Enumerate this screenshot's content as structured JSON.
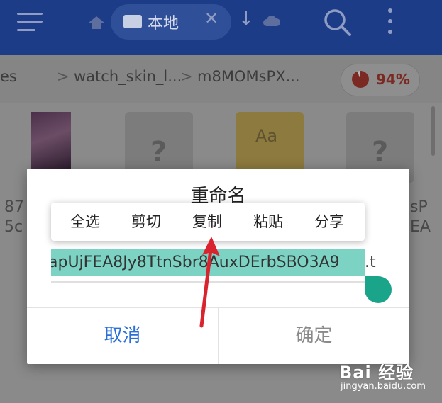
{
  "appbar": {
    "location_label": "本地",
    "close_glyph": "✕",
    "down_glyph": "↓",
    "icons": [
      "menu-icon",
      "home-icon",
      "folder-icon",
      "cloud-icon",
      "search-icon",
      "more-vert-icon"
    ]
  },
  "breadcrumb": {
    "items": [
      "es",
      ">",
      "watch_skin_l...",
      ">",
      "m8MOMsPX..."
    ]
  },
  "storage": {
    "usage": "94%",
    "usage_fraction": 0.94,
    "color": "#c0392b"
  },
  "files": {
    "left_label_1": "87",
    "left_label_2": "5c",
    "right_label_1": "sP",
    "right_label_2": "EA",
    "doc_badge": "Aa",
    "unknown_glyph": "?"
  },
  "dialog": {
    "title": "重命名",
    "input_selected": "apUjFEA8Jy8TtnSbr8AuxDErbSBO3A9",
    "input_tail": ".t",
    "cancel_label": "取消",
    "ok_label": "确定"
  },
  "context_menu": {
    "items": [
      "全选",
      "剪切",
      "复制",
      "粘贴",
      "分享"
    ]
  },
  "watermark": {
    "logo": "Bai 经验",
    "url": "jingyan.baidu.com"
  },
  "colors": {
    "appbar": "#1c3c88",
    "selection": "#7dd3c3",
    "handle": "#1aa58a",
    "cancel": "#2a6fd6",
    "arrow": "#d9232e"
  }
}
